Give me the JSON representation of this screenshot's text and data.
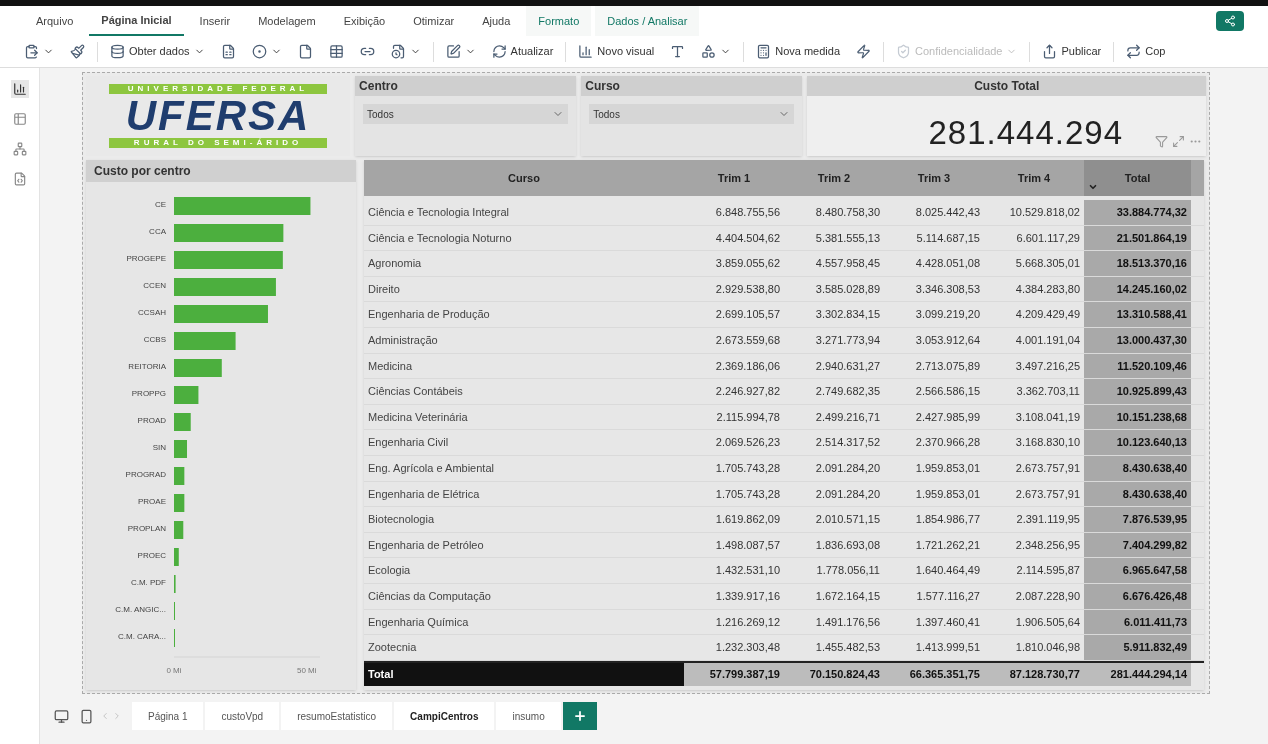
{
  "ribbon_tabs": [
    {
      "label": "Arquivo",
      "selected": false,
      "kind": "plain"
    },
    {
      "label": "Página Inicial",
      "selected": true,
      "kind": "plain"
    },
    {
      "label": "Inserir",
      "selected": false,
      "kind": "plain"
    },
    {
      "label": "Modelagem",
      "selected": false,
      "kind": "plain"
    },
    {
      "label": "Exibição",
      "selected": false,
      "kind": "plain"
    },
    {
      "label": "Otimizar",
      "selected": false,
      "kind": "plain"
    },
    {
      "label": "Ajuda",
      "selected": false,
      "kind": "plain"
    },
    {
      "label": "Formato",
      "selected": false,
      "kind": "context"
    },
    {
      "label": "Dados / Analisar",
      "selected": false,
      "kind": "context"
    }
  ],
  "toolbar": [
    {
      "caret": true,
      "disabled": false
    },
    {
      "caret": false,
      "disabled": false
    },
    {
      "label": "Obter dados",
      "caret": true,
      "disabled": false
    },
    {
      "caret": false,
      "disabled": false
    },
    {
      "caret": true,
      "disabled": false
    },
    {
      "caret": false,
      "disabled": false
    },
    {
      "caret": false,
      "disabled": false
    },
    {
      "caret": false,
      "disabled": false
    },
    {
      "caret": true,
      "disabled": false
    },
    {
      "caret": true,
      "disabled": false
    },
    {
      "label": "Atualizar",
      "caret": false,
      "disabled": false
    },
    {
      "label": "Novo visual",
      "caret": false,
      "disabled": false
    },
    {
      "caret": false,
      "disabled": false
    },
    {
      "caret": true,
      "disabled": false
    },
    {
      "label": "Nova medida",
      "caret": false,
      "disabled": false
    },
    {
      "caret": false,
      "disabled": false
    },
    {
      "label": "Confidencialidade",
      "caret": true,
      "disabled": true
    },
    {
      "label": "Publicar",
      "caret": false,
      "disabled": false
    },
    {
      "label": "Cop",
      "caret": false,
      "disabled": false
    }
  ],
  "side_rail": [
    {
      "selected": true
    },
    {
      "selected": false
    },
    {
      "selected": false
    },
    {
      "selected": false
    }
  ],
  "logo": {
    "top_band": "UNIVERSIDADE FEDERAL",
    "name": "UFERSA",
    "bottom_band": "RURAL DO SEMI-ÁRIDO"
  },
  "slicers": [
    {
      "title": "Centro",
      "value": "Todos"
    },
    {
      "title": "Curso",
      "value": "Todos"
    }
  ],
  "card": {
    "title": "Custo Total",
    "value": "281.444.294"
  },
  "bar_chart": {
    "title": "Custo por centro",
    "chart_data": {
      "type": "bar",
      "orientation": "horizontal",
      "categories": [
        "CE",
        "CCA",
        "PROGEPE",
        "CCEN",
        "CCSAH",
        "CCBS",
        "REITORIA",
        "PROPPG",
        "PROAD",
        "SIN",
        "PROGRAD",
        "PROAE",
        "PROPLAN",
        "PROEC",
        "C.M. PDF",
        "C.M. ANGIC...",
        "C.M. CARA..."
      ],
      "series": [
        {
          "color": "#4caf3e",
          "values": [
            51.4,
            41.2,
            41.0,
            38.4,
            35.4,
            23.2,
            18.0,
            9.2,
            6.3,
            4.9,
            3.9,
            3.9,
            3.5,
            1.8,
            0.6,
            0.3,
            0.3
          ]
        }
      ],
      "xlim": [
        0,
        55
      ],
      "xticks": [
        {
          "value": 0,
          "label": "0 Mi"
        },
        {
          "value": 50,
          "label": "50 Mi"
        }
      ]
    }
  },
  "table": {
    "columns": [
      {
        "label": "Curso",
        "sorted": false
      },
      {
        "label": "Trim 1",
        "sorted": false
      },
      {
        "label": "Trim 2",
        "sorted": false
      },
      {
        "label": "Trim 3",
        "sorted": false
      },
      {
        "label": "Trim 4",
        "sorted": false
      },
      {
        "label": "Total",
        "sorted": true
      }
    ],
    "rows": [
      [
        "Ciência e Tecnologia Integral",
        "6.848.755,56",
        "8.480.758,30",
        "8.025.442,43",
        "10.529.818,02",
        "33.884.774,32"
      ],
      [
        "Ciência e Tecnologia Noturno",
        "4.404.504,62",
        "5.381.555,13",
        "5.114.687,15",
        "6.601.117,29",
        "21.501.864,19"
      ],
      [
        "Agronomia",
        "3.859.055,62",
        "4.557.958,45",
        "4.428.051,08",
        "5.668.305,01",
        "18.513.370,16"
      ],
      [
        "Direito",
        "2.929.538,80",
        "3.585.028,89",
        "3.346.308,53",
        "4.384.283,80",
        "14.245.160,02"
      ],
      [
        "Engenharia de Produção",
        "2.699.105,57",
        "3.302.834,15",
        "3.099.219,20",
        "4.209.429,49",
        "13.310.588,41"
      ],
      [
        "Administração",
        "2.673.559,68",
        "3.271.773,94",
        "3.053.912,64",
        "4.001.191,04",
        "13.000.437,30"
      ],
      [
        "Medicina",
        "2.369.186,06",
        "2.940.631,27",
        "2.713.075,89",
        "3.497.216,25",
        "11.520.109,46"
      ],
      [
        "Ciências Contábeis",
        "2.246.927,82",
        "2.749.682,35",
        "2.566.586,15",
        "3.362.703,11",
        "10.925.899,43"
      ],
      [
        "Medicina Veterinária",
        "2.115.994,78",
        "2.499.216,71",
        "2.427.985,99",
        "3.108.041,19",
        "10.151.238,68"
      ],
      [
        "Engenharia Civil",
        "2.069.526,23",
        "2.514.317,52",
        "2.370.966,28",
        "3.168.830,10",
        "10.123.640,13"
      ],
      [
        "Eng. Agrícola e Ambiental",
        "1.705.743,28",
        "2.091.284,20",
        "1.959.853,01",
        "2.673.757,91",
        "8.430.638,40"
      ],
      [
        "Engenharia de Elétrica",
        "1.705.743,28",
        "2.091.284,20",
        "1.959.853,01",
        "2.673.757,91",
        "8.430.638,40"
      ],
      [
        "Biotecnologia",
        "1.619.862,09",
        "2.010.571,15",
        "1.854.986,77",
        "2.391.119,95",
        "7.876.539,95"
      ],
      [
        "Engenharia de Petróleo",
        "1.498.087,57",
        "1.836.693,08",
        "1.721.262,21",
        "2.348.256,95",
        "7.404.299,82"
      ],
      [
        "Ecologia",
        "1.432.531,10",
        "1.778.056,11",
        "1.640.464,49",
        "2.114.595,87",
        "6.965.647,58"
      ],
      [
        "Ciências da Computação",
        "1.339.917,16",
        "1.672.164,15",
        "1.577.116,27",
        "2.087.228,90",
        "6.676.426,48"
      ],
      [
        "Engenharia Química",
        "1.216.269,12",
        "1.491.176,56",
        "1.397.460,41",
        "1.906.505,64",
        "6.011.411,73"
      ],
      [
        "Zootecnia",
        "1.232.303,48",
        "1.455.482,53",
        "1.413.999,51",
        "1.810.046,98",
        "5.911.832,49"
      ]
    ],
    "total_row": [
      "Total",
      "57.799.387,19",
      "70.150.824,43",
      "66.365.351,75",
      "87.128.730,77",
      "281.444.294,14"
    ]
  },
  "page_tabs": [
    {
      "label": "Página 1",
      "selected": false
    },
    {
      "label": "custoVpd",
      "selected": false
    },
    {
      "label": "resumoEstatistico",
      "selected": false
    },
    {
      "label": "CampiCentros",
      "selected": true
    },
    {
      "label": "insumo",
      "selected": false
    }
  ]
}
